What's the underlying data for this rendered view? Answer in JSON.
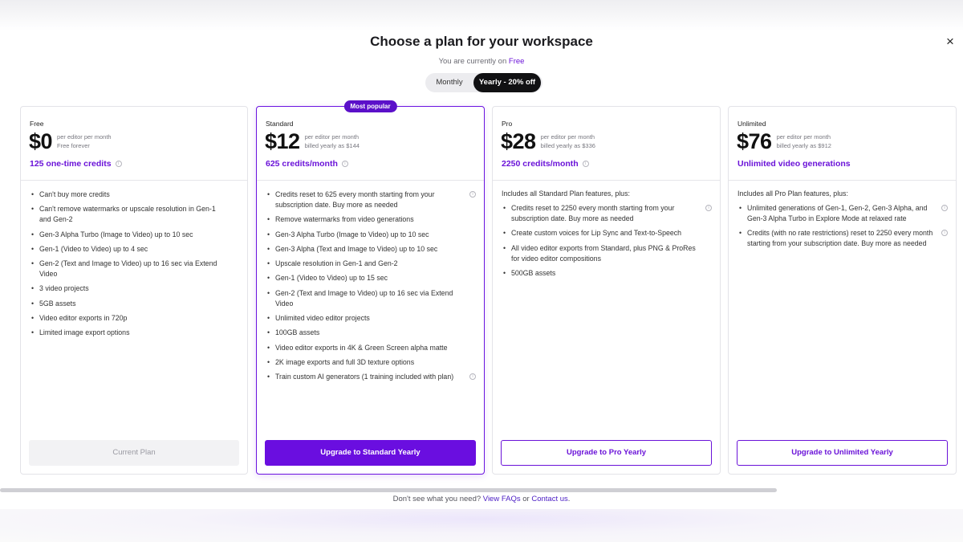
{
  "header": {
    "title": "Choose a plan for your workspace",
    "current_prefix": "You are currently on",
    "current_plan": "Free",
    "close_glyph": "×"
  },
  "billing_toggle": {
    "monthly": "Monthly",
    "yearly": "Yearly - 20% off",
    "selected": "yearly"
  },
  "plans": [
    {
      "name": "Free",
      "price": "$0",
      "price_meta_1": "per editor per month",
      "price_meta_2": "Free forever",
      "credits": "125 one-time credits",
      "intro": "",
      "features": [
        {
          "text": "Can't buy more credits"
        },
        {
          "text": "Can't remove watermarks or upscale resolution in Gen-1 and Gen-2"
        },
        {
          "text": "Gen-3 Alpha Turbo (Image to Video) up to 10 sec"
        },
        {
          "text": "Gen-1 (Video to Video) up to 4 sec"
        },
        {
          "text": "Gen-2 (Text and Image to Video) up to 16 sec via Extend Video"
        },
        {
          "text": "3 video projects"
        },
        {
          "text": "5GB assets"
        },
        {
          "text": "Video editor exports in 720p"
        },
        {
          "text": "Limited image export options"
        }
      ],
      "cta": "Current Plan"
    },
    {
      "name": "Standard",
      "badge": "Most popular",
      "price": "$12",
      "price_meta_1": "per editor per month",
      "price_meta_2": "billed yearly as $144",
      "credits": "625 credits/month",
      "intro": "",
      "features": [
        {
          "text": "Credits reset to 625 every month starting from your subscription date. Buy more as needed"
        },
        {
          "text": "Remove watermarks from video generations"
        },
        {
          "text": "Gen-3 Alpha Turbo (Image to Video) up to 10 sec"
        },
        {
          "text": "Gen-3 Alpha (Text and Image to Video) up to 10 sec"
        },
        {
          "text": "Upscale resolution in Gen-1 and Gen-2"
        },
        {
          "text": "Gen-1 (Video to Video) up to 15 sec"
        },
        {
          "text": "Gen-2 (Text and Image to Video) up to 16 sec via Extend Video"
        },
        {
          "text": "Unlimited video editor projects"
        },
        {
          "text": "100GB assets"
        },
        {
          "text": "Video editor exports in 4K & Green Screen alpha matte"
        },
        {
          "text": "2K image exports and full 3D texture options"
        },
        {
          "text": "Train custom AI generators (1 training included with plan)"
        }
      ],
      "cta": "Upgrade to Standard Yearly"
    },
    {
      "name": "Pro",
      "price": "$28",
      "price_meta_1": "per editor per month",
      "price_meta_2": "billed yearly as $336",
      "credits": "2250 credits/month",
      "intro": "Includes all Standard Plan features, plus:",
      "features": [
        {
          "text": "Credits reset to 2250 every month starting from your subscription date. Buy more as needed"
        },
        {
          "text": "Create custom voices for Lip Sync and Text-to-Speech"
        },
        {
          "text": "All video editor exports from Standard, plus PNG & ProRes for video editor compositions"
        },
        {
          "text": "500GB assets"
        }
      ],
      "cta": "Upgrade to Pro Yearly"
    },
    {
      "name": "Unlimited",
      "price": "$76",
      "price_meta_1": "per editor per month",
      "price_meta_2": "billed yearly as $912",
      "credits": "Unlimited video generations",
      "intro": "Includes all Pro Plan features, plus:",
      "features": [
        {
          "text": "Unlimited generations of Gen-1, Gen-2, Gen-3 Alpha, and Gen-3 Alpha Turbo in Explore Mode at relaxed rate"
        },
        {
          "text": "Credits (with no rate restrictions) reset to 2250 every month starting from your subscription date. Buy more as needed"
        }
      ],
      "cta": "Upgrade to Unlimited Yearly"
    }
  ],
  "info_glyph": "i",
  "bullet_glyph": "•",
  "footer": {
    "prefix": "Don't see what you need?",
    "faq_link": "View FAQs",
    "or": "or",
    "contact_link": "Contact us",
    "suffix": "."
  },
  "colors": {
    "accent": "#6a0ee0",
    "accent_text": "#6a12d8",
    "badge": "#5b10c9",
    "toggle_active": "#111113"
  }
}
